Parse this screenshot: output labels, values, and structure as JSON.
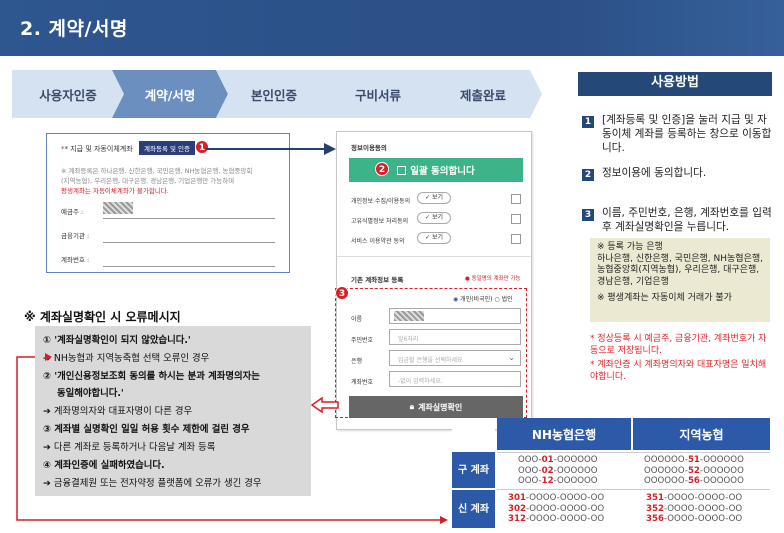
{
  "header": {
    "title": "2. 계약/서명"
  },
  "steps": [
    "사용자인증",
    "계약/서명",
    "본인인증",
    "구비서류",
    "제출완료"
  ],
  "howto": {
    "title": "사용방법",
    "items": [
      {
        "num": "1",
        "text": "[계좌등록 및 인증]을 눌러 지급 및 자동이체 계좌를 등록하는 창으로 이동합니다."
      },
      {
        "num": "2",
        "text": "정보이용에 동의합니다."
      },
      {
        "num": "3",
        "text": "이름, 주민번호, 은행, 계좌번호를 입력 후 계좌실명확인을 누릅니다."
      }
    ],
    "note_title": "※ 등록 가능 은행",
    "note_banks": "하나은행, 신한은행, 국민은행, NH농협은행, 농협중앙회(지역농협), 우리은행, 대구은행, 경남은행, 기업은행",
    "note_warn": "※ 평생계좌는 자동이체 거래가 불가",
    "red_notes": [
      "*  정상등록 시 예금주, 금융기관, 계좌번호가 자동으로 저장됩니다.",
      "*  계좌인증 시 계좌명의자와 대표자명은 일치해야합니다."
    ]
  },
  "card1": {
    "label": "* 지급 및 자동이체계좌",
    "button": "계좌등록 및 인증",
    "badge": "1",
    "desc1": "※ 계좌등록은 하나은행, 신한은행, 국민은행, NH농협은행, 농협중앙회",
    "desc2": "(지역농협), 우리은행, 대구은행, 경남은행, 기업은행만 가능하며",
    "desc3": "평생계좌는 자동이체계좌가 불가합니다.",
    "fields": [
      "예금주 :",
      "금융기관 :",
      "계좌번호 :"
    ]
  },
  "card2": {
    "section1": "정보이용동의",
    "agree_all": "일괄 동의합니다",
    "badge2": "2",
    "agree_items": [
      "개인정보 수집/이용동의",
      "고유식별정보 처리동의",
      "서비스 이용약관 동의"
    ],
    "view_label": "보기",
    "section2": "기존 계좌정보 등록",
    "section2_note": "동일명의 계좌만 가능",
    "badge3": "3",
    "radio1": "개인(비국인)",
    "radio2": "법인",
    "rows": [
      {
        "label": "이름",
        "placeholder": ""
      },
      {
        "label": "주민번호",
        "placeholder": "앞6자리"
      },
      {
        "label": "은행",
        "placeholder": "입금할 은행을 선택하세요"
      },
      {
        "label": "계좌번호",
        "placeholder": "-없이 입력하세요."
      }
    ],
    "confirm_button": "계좌실명확인"
  },
  "errors": {
    "title": "※ 계좌실명확인 시 오류메시지",
    "lines": [
      {
        "text": "① '계좌실명확인이 되지 않았습니다.'",
        "bold": true
      },
      {
        "text": "➔ NH농협과 지역농축협 선택 오류인 경우",
        "bold": false
      },
      {
        "text": "② '개인신용정보조회 동의를 하시는 분과 계좌명의자는",
        "bold": true
      },
      {
        "text": "동일해야합니다.'",
        "bold": true
      },
      {
        "text": "➔ 계좌명의자와 대표자명이 다른 경우",
        "bold": false
      },
      {
        "text": "③ 계좌별 실명확인 일일 허용 횟수 제한에 걸린 경우",
        "bold": true
      },
      {
        "text": "➔ 다른 계좌로 등록하거나 다음날 계좌 등록",
        "bold": false
      },
      {
        "text": "④ 계좌인증에 실패하였습니다.",
        "bold": true
      },
      {
        "text": "➔ 금융결제원 또는 전자약정 플랫폼에 오류가 생긴 경우",
        "bold": false
      }
    ]
  },
  "bank_table": {
    "headers": [
      "NH농협은행",
      "지역농협"
    ],
    "old_label": "구 계좌",
    "new_label": "신 계좌",
    "old_nh": [
      [
        "OOO-",
        "01",
        "-OOOOOO"
      ],
      [
        "OOO-",
        "02",
        "-OOOOOO"
      ],
      [
        "OOO-",
        "12",
        "-OOOOOO"
      ]
    ],
    "old_local": [
      [
        "OOOOOO-",
        "51",
        "-OOOOOO"
      ],
      [
        "OOOOOO-",
        "52",
        "-OOOOOO"
      ],
      [
        "OOOOOO-",
        "56",
        "-OOOOOO"
      ]
    ],
    "new_nh": [
      [
        "301",
        "-OOOO-OOOO-OO"
      ],
      [
        "302",
        "-OOOO-OOOO-OO"
      ],
      [
        "312",
        "-OOOO-OOOO-OO"
      ]
    ],
    "new_local": [
      [
        "351",
        "-OOOO-OOOO-OO"
      ],
      [
        "352",
        "-OOOO-OOOO-OO"
      ],
      [
        "356",
        "-OOOO-OOOO-OO"
      ]
    ]
  },
  "colors": {
    "header": "#2b4f86",
    "accent": "#244979",
    "badge": "#d61f26",
    "green": "#3db38a",
    "table": "#2c5aa8"
  }
}
